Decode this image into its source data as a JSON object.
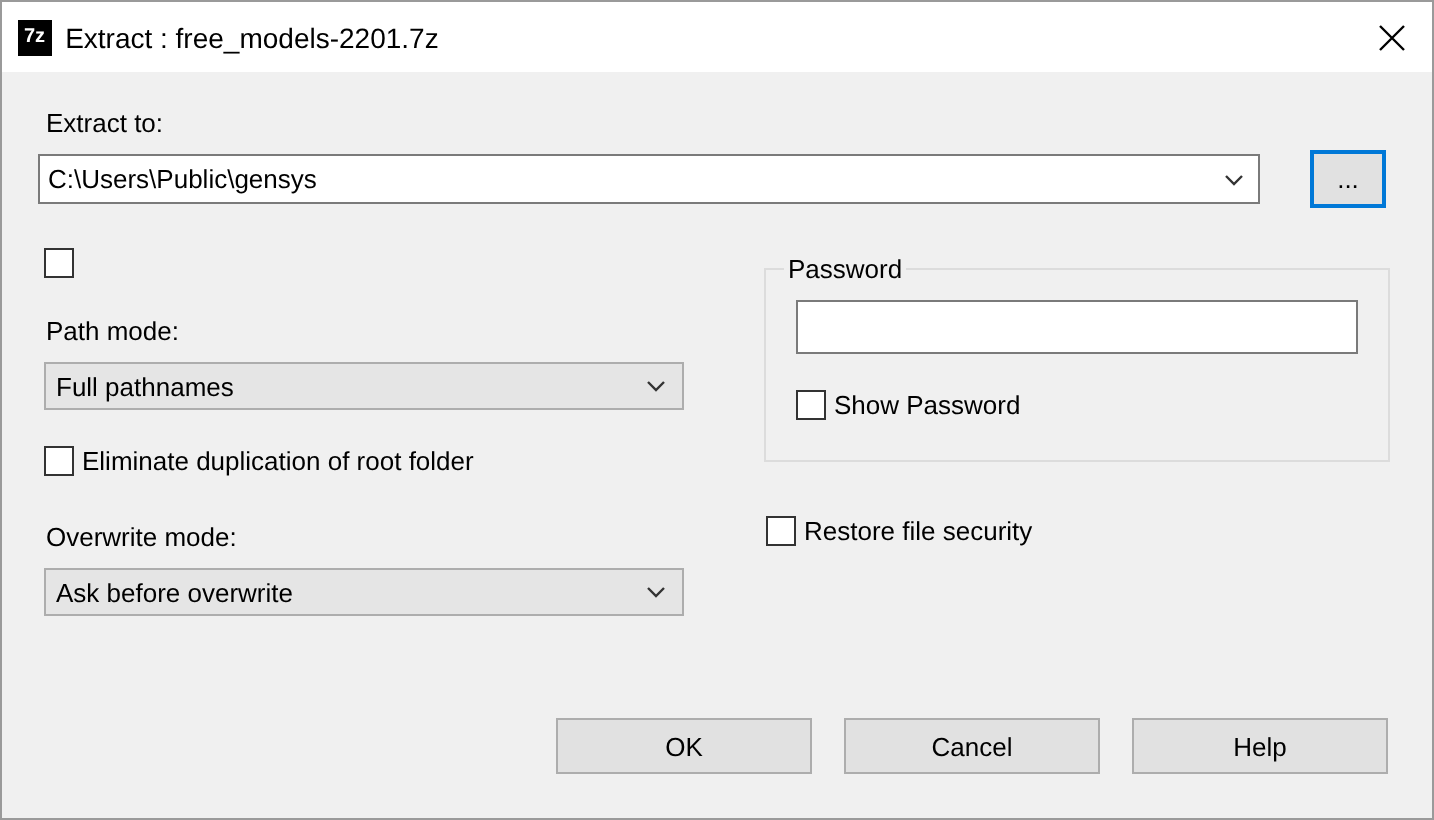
{
  "window": {
    "title": "Extract : free_models-2201.7z",
    "icon": "7z"
  },
  "extract_to": {
    "label": "Extract to:",
    "value": "C:\\Users\\Public\\gensys",
    "browse": "..."
  },
  "top_checkbox": {
    "checked": false
  },
  "path_mode": {
    "label": "Path mode:",
    "value": "Full pathnames"
  },
  "eliminate_root": {
    "label": "Eliminate duplication of root folder",
    "checked": false
  },
  "overwrite_mode": {
    "label": "Overwrite mode:",
    "value": "Ask before overwrite"
  },
  "password": {
    "title": "Password",
    "show_password": {
      "label": "Show Password",
      "checked": false
    }
  },
  "restore_security": {
    "label": "Restore file security",
    "checked": false
  },
  "buttons": [
    "OK",
    "Cancel",
    "Help"
  ]
}
